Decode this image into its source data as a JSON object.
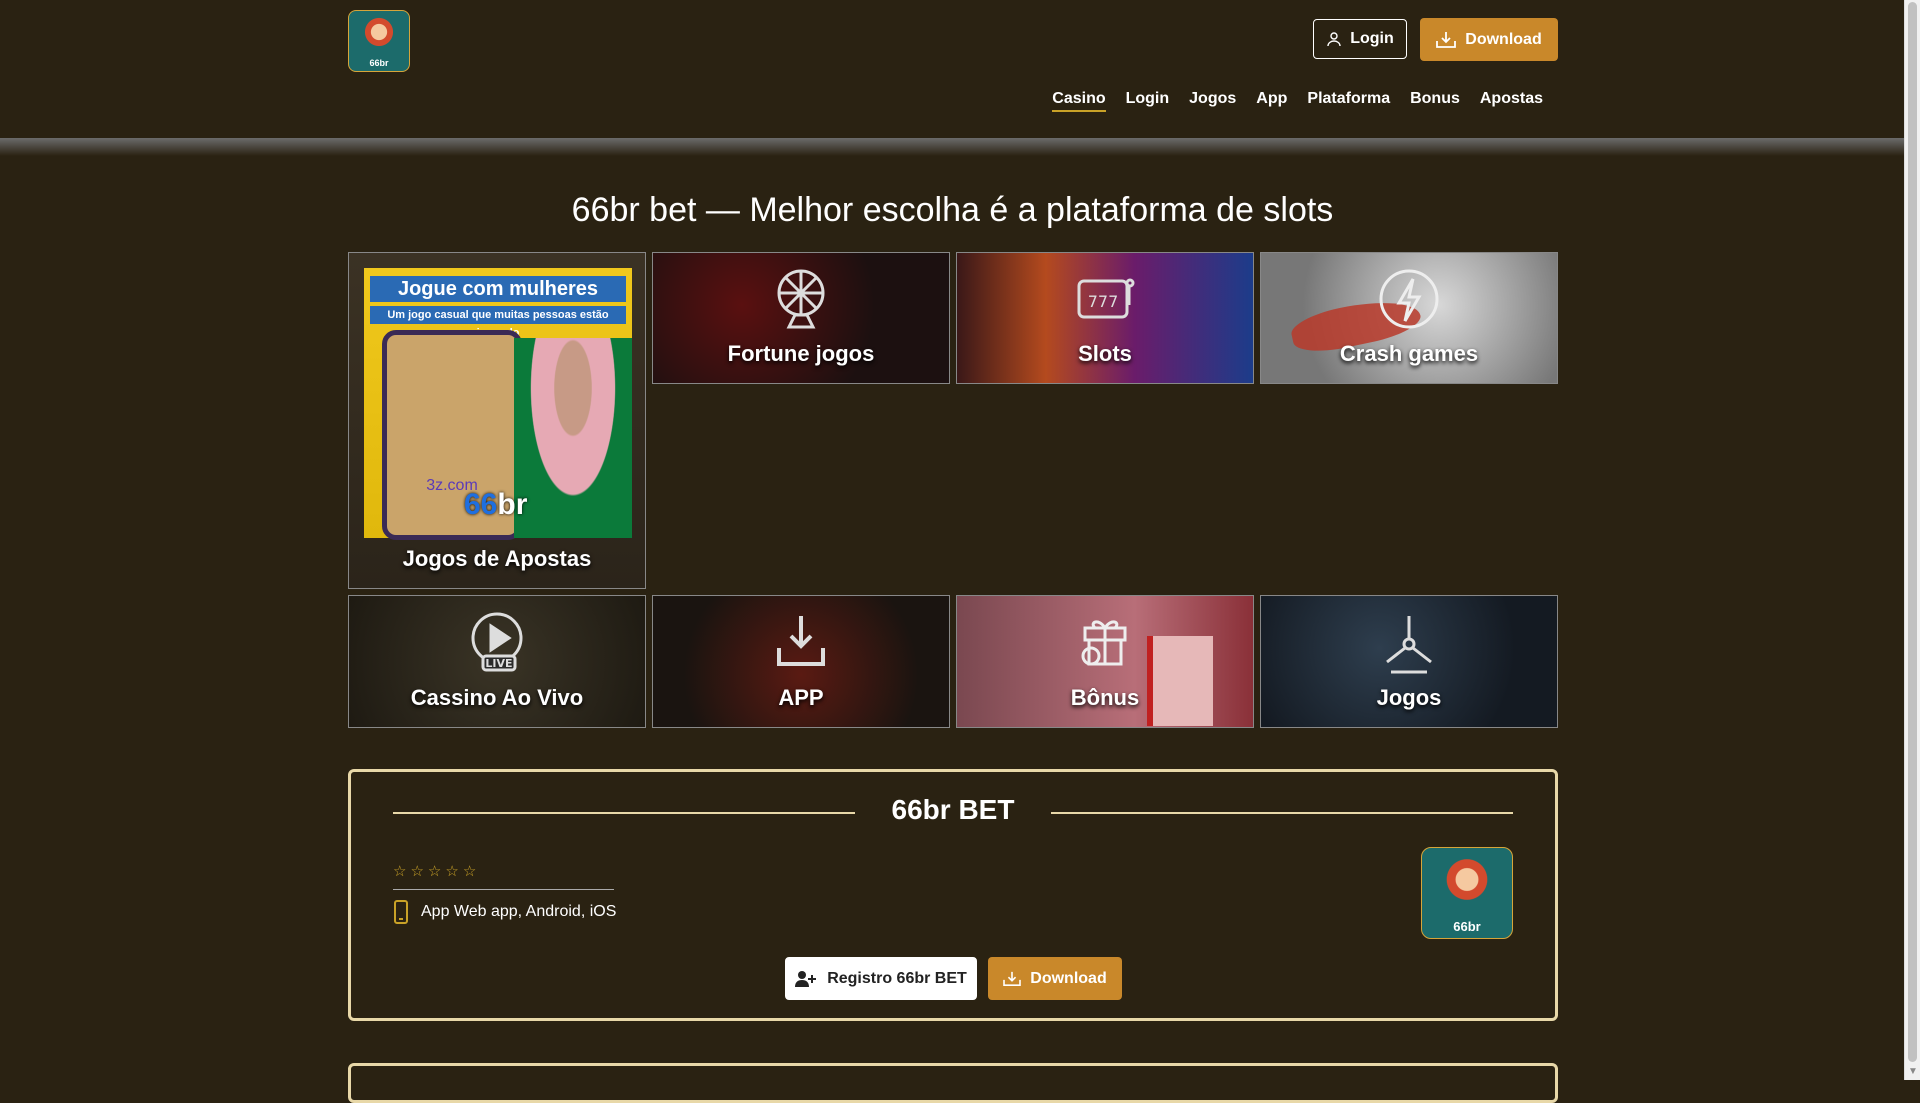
{
  "header": {
    "logo_text": "66br",
    "login_label": "Login",
    "download_label": "Download",
    "nav": [
      {
        "label": "Casino"
      },
      {
        "label": "Login"
      },
      {
        "label": "Jogos"
      },
      {
        "label": "App"
      },
      {
        "label": "Plataforma"
      },
      {
        "label": "Bonus"
      },
      {
        "label": "Apostas"
      }
    ]
  },
  "page_title": "66br bet — Melhor escolha é a plataforma de slots",
  "cards": [
    {
      "label": "Jogos de Apostas"
    },
    {
      "label": "Fortune jogos"
    },
    {
      "label": "Slots"
    },
    {
      "label": "Crash games"
    },
    {
      "label": "Cassino Ao Vivo"
    },
    {
      "label": "APP"
    },
    {
      "label": "Bônus"
    },
    {
      "label": "Jogos"
    }
  ],
  "poster": {
    "banner": "Jogue com mulheres bonitas",
    "subbanner": "Um jogo casual que muitas pessoas estão jogando",
    "site": "3z.com",
    "brand_a": "66",
    "brand_b": "br"
  },
  "infobox": {
    "title": "66br BET",
    "rating_stars": 5,
    "app_label": "App Web app, Android, iOS",
    "registro_label": "Registro 66br BET",
    "download_label": "Download"
  },
  "colors": {
    "background": "#2a2212",
    "accent": "#c9882a",
    "border": "#e8d8a8"
  }
}
